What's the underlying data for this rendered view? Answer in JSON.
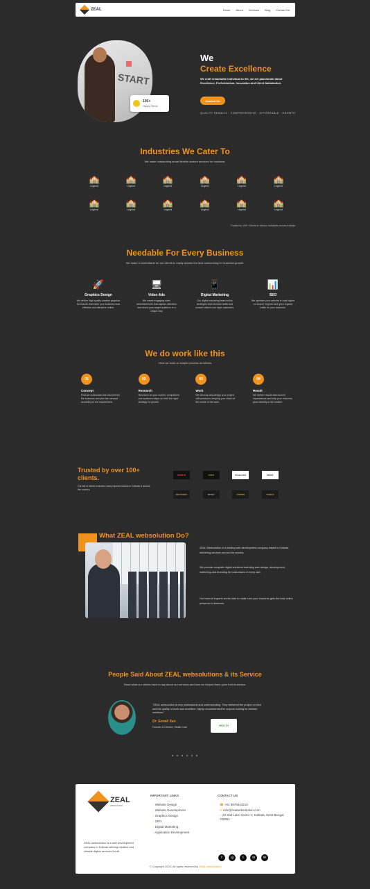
{
  "nav": {
    "brand": "ZEAL",
    "links": [
      "Home",
      "About",
      "Services",
      "Blog",
      "Contact Us"
    ]
  },
  "hero": {
    "line1": "We",
    "line2": "Create Excellence",
    "desc": "We craft remarkable individual to life, we are passionate about Excellence, Perfectionism, Innovation and Client Satisfaction.",
    "button": "Contact Us",
    "tagline": "QUALITY RESULTS · COMPREHENSIVE · AFFORDABLE · GROWTH",
    "badge_title": "100+",
    "badge_sub": "Happy Clients",
    "board_text": "START"
  },
  "industries": {
    "title": "Industries We Cater To",
    "subtitle": "We make outstanding smart flexible custom services for business.",
    "label": "Legend",
    "footnote": "Trusted by 100+ Clients in Various Industries across Kolkata"
  },
  "services": {
    "title": "Needable For Every Business",
    "subtitle": "We make it comfortable for our clients to easily access the best outsourcing for business growth.",
    "items": [
      {
        "icon": "🚀",
        "title": "Graphics Design",
        "text": "We deliver high quality creative graphics for brands that make your business look effective and attractive online."
      },
      {
        "icon": "🖥",
        "title": "Video Ads",
        "text": "We create engaging video advertisements that capture attention and reach your target audience in a unique way."
      },
      {
        "icon": "📱",
        "title": "Digital Marketing",
        "text": "Our digital marketing team builds strategies that increase traffic and convert visitors into loyal customers."
      },
      {
        "icon": "📊",
        "title": "SEO",
        "text": "We optimize your website to rank higher on search engines and grow organic traffic for your business."
      }
    ]
  },
  "process": {
    "title": "We do work like this",
    "subtitle": "Here we work on simple process as follows",
    "steps": [
      {
        "num": "01",
        "title": "Concept",
        "text": "First we understand the idea behind the business and plan the concept according to the requirement."
      },
      {
        "num": "02",
        "title": "Research",
        "text": "Research on your market, competitors and audience helps us build the right strategy for growth."
      },
      {
        "num": "03",
        "title": "Work",
        "text": "We develop and design your project with precision, keeping your vision at the centre of the work."
      },
      {
        "num": "04",
        "title": "Result",
        "text": "We deliver results that exceed expectations and help your business grow steadily in the market."
      }
    ]
  },
  "clients": {
    "title": "Trusted by over 100+ clients.",
    "text": "Our list of clients includes many reputed names in Kolkata & across the country.",
    "logos": [
      "SPORTS",
      "CAFE",
      "Dream Box",
      "MAHA",
      "RECOVERY",
      "MUSIC",
      "TOWER",
      "SHIELD"
    ]
  },
  "about": {
    "title": "What ZEAL websolution Do?",
    "p1": "ZEAL Websolution is a leading web development company based in Kolkata, delivering services across the country.",
    "p2": "We provide complete digital solutions including web design, development, marketing and branding for businesses of every size.",
    "p3": "Our team of experts works hard to make sure your business gets the best online presence it deserves."
  },
  "testimonial": {
    "title": "People Said About ZEAL websolutions & its Service",
    "subtitle": "Read what our clients have to say about our services and how we helped them grow their business.",
    "quote": "\"ZEAL websolution is very professional and understanding. They delivered the project on time and the quality of work was excellent. Highly recommended for anyone looking for website solutions.\"",
    "name": "Dr. Sonali Sen",
    "role": "Founder & Director, Health Care",
    "company_logo": "HEALTH"
  },
  "footer": {
    "brand": "ZEAL",
    "brand_sub": "websolution",
    "about": "ZEAL websolution is a web development company in Kolkata offering creative and reliable digital services for all.",
    "services_title": "IMPORTANT LINKS",
    "services": [
      "Website Design",
      "Website Development",
      "Graphics Design",
      "SEO",
      "Digital Marketing",
      "Application Development"
    ],
    "contact_title": "CONTACT US",
    "phone": "+91 9876543210",
    "email": "info@zealwebsolution.com",
    "address": "22 Salt Lake Sector V, Kolkata, West Bengal 700091",
    "copyright": "© Copyright 2023, All rights reserved by",
    "copyright_brand": "ZEAL websolution"
  },
  "colors": {
    "accent": "#f0931e",
    "bg": "#2b2b2b"
  }
}
